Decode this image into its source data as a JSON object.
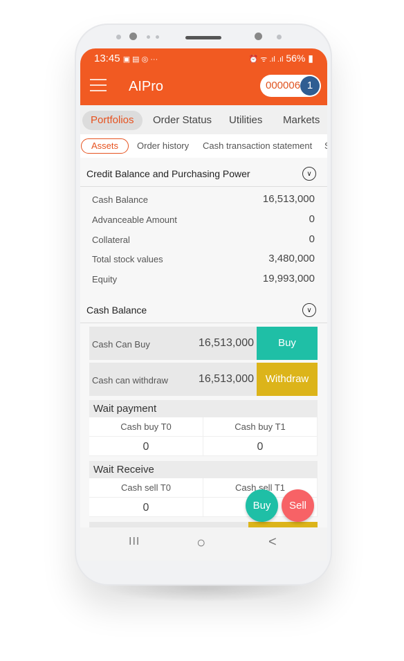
{
  "status_bar": {
    "time": "13:45",
    "icons": "▣ ▤ ◎ ···",
    "right": "⏰ ᯤ .ıl .ıl",
    "battery": "56%"
  },
  "header": {
    "title": "AIPro",
    "account": "000006",
    "badge": "1"
  },
  "tabs": [
    {
      "label": "Portfolios"
    },
    {
      "label": "Order Status"
    },
    {
      "label": "Utilities"
    },
    {
      "label": "Markets"
    }
  ],
  "subtabs": [
    {
      "label": "Assets"
    },
    {
      "label": "Order history"
    },
    {
      "label": "Cash transaction statement"
    },
    {
      "label": "S"
    }
  ],
  "credit": {
    "title": "Credit Balance and Purchasing Power",
    "rows": [
      {
        "label": "Cash Balance",
        "value": "16,513,000"
      },
      {
        "label": "Advanceable Amount",
        "value": "0"
      },
      {
        "label": "Collateral",
        "value": "0"
      },
      {
        "label": "Total stock values",
        "value": "3,480,000"
      },
      {
        "label": "Equity",
        "value": "19,993,000"
      }
    ]
  },
  "cash": {
    "title": "Cash Balance",
    "can_buy": {
      "label": "Cash Can Buy",
      "value": "16,513,000",
      "button": "Buy"
    },
    "can_withdraw": {
      "label": "Cash can withdraw",
      "value": "16,513,000",
      "button": "Withdraw"
    },
    "wait_payment": {
      "title": "Wait payment",
      "cols": [
        "Cash buy T0",
        "Cash buy T1"
      ],
      "values": [
        "0",
        "0"
      ]
    },
    "wait_receive": {
      "title": "Wait Receive",
      "cols": [
        "Cash sell T0",
        "Cash sell T1"
      ],
      "values": [
        "0",
        ""
      ]
    }
  },
  "fab": {
    "buy": "Buy",
    "sell": "Sell"
  },
  "nav": {
    "recent": "III",
    "home": "○",
    "back": "<"
  },
  "colors": {
    "brand": "#f15a22",
    "buy": "#1fbfa6",
    "withdraw": "#dcb41a",
    "sell": "#f76266",
    "badge": "#2f5d92"
  }
}
